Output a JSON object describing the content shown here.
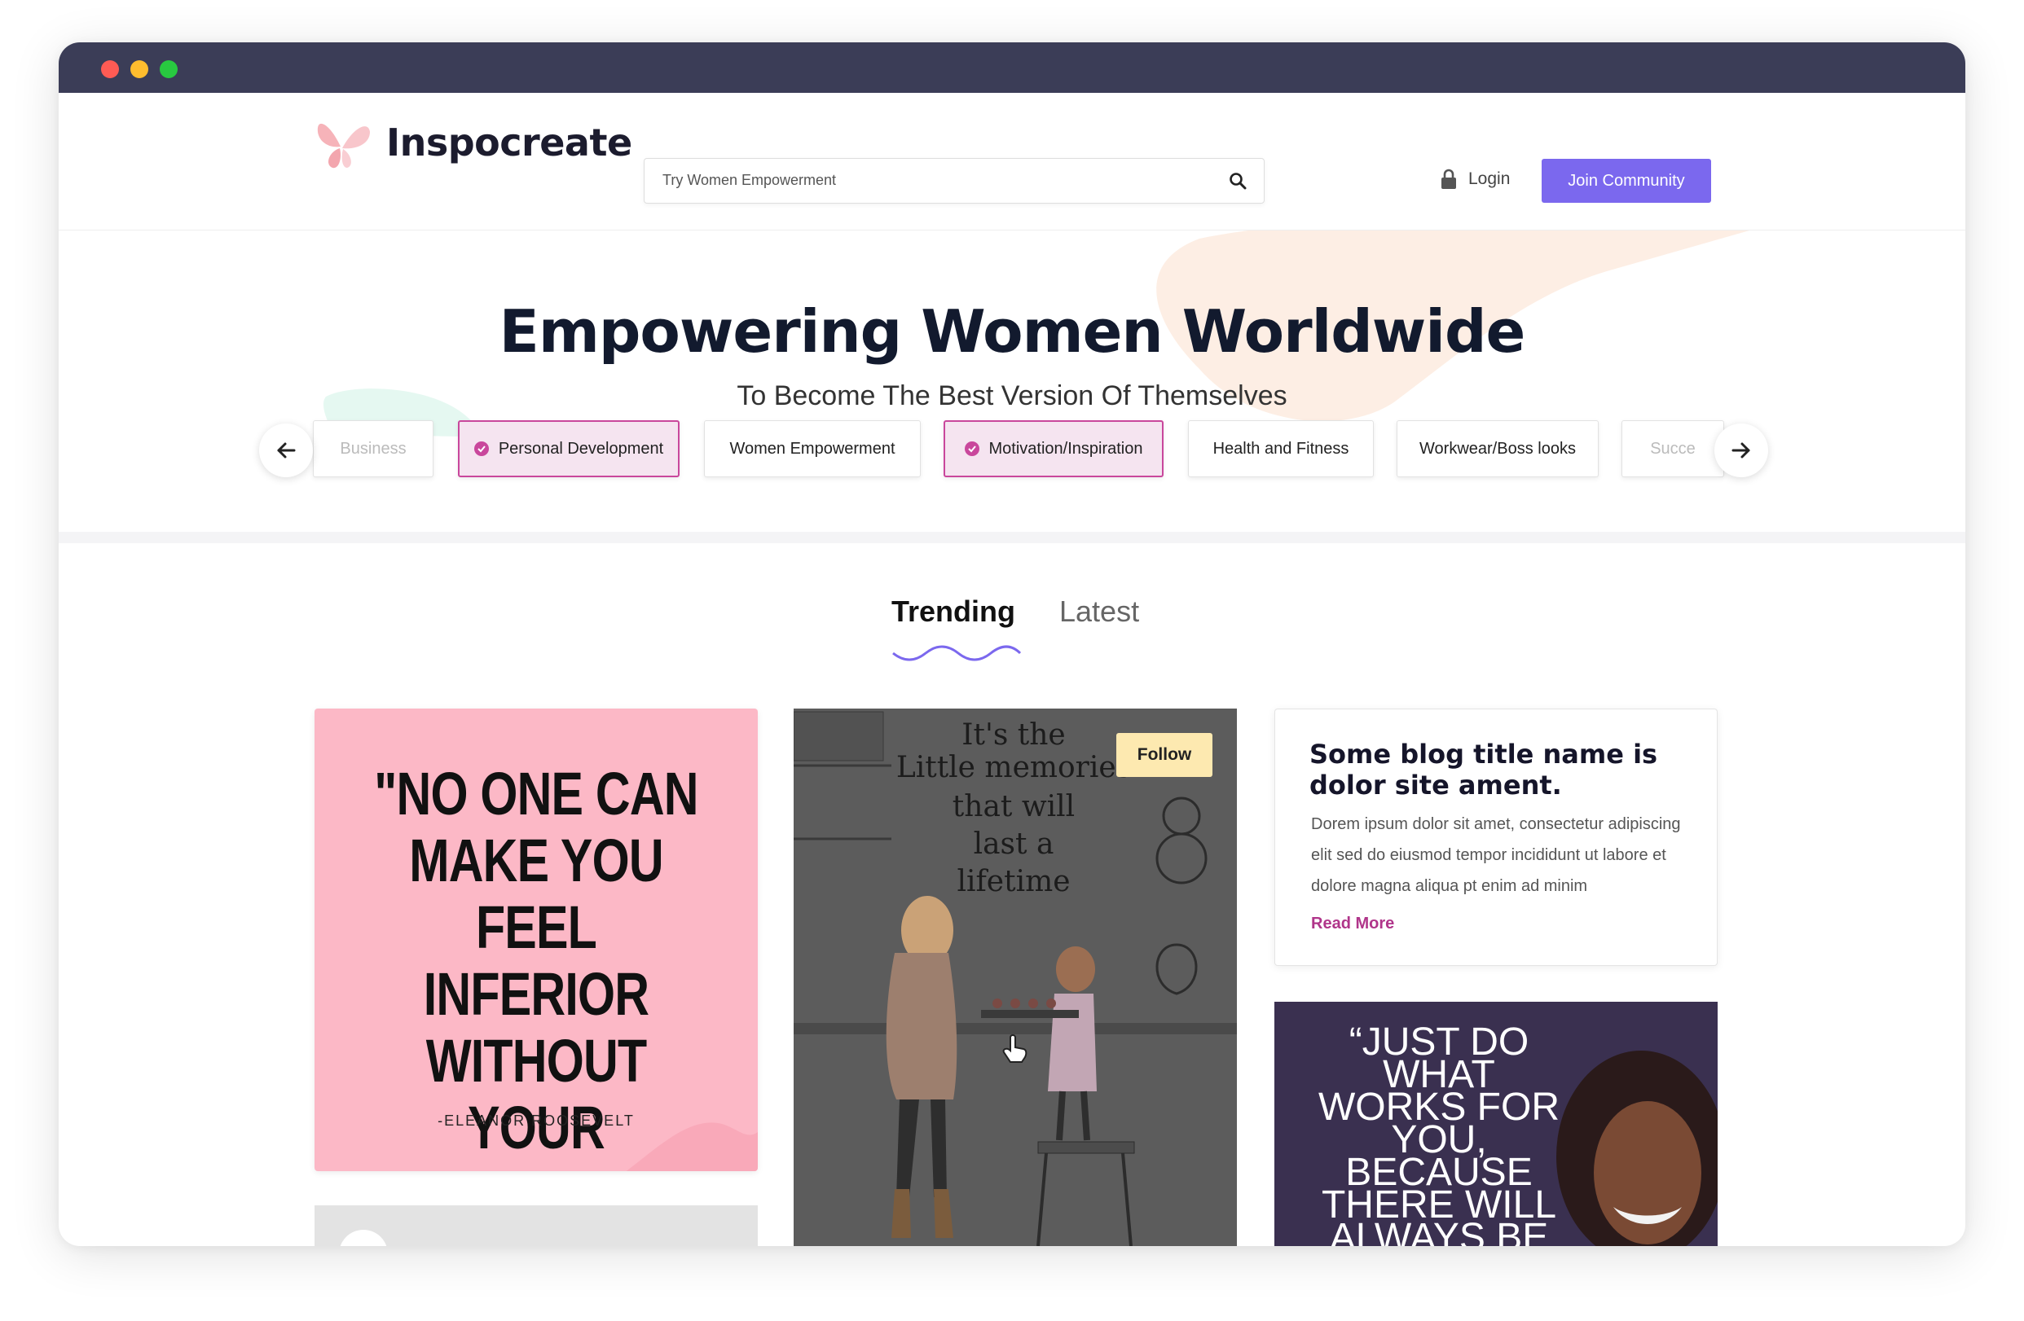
{
  "window": {
    "controls": [
      "close",
      "minimize",
      "maximize"
    ]
  },
  "nav": {
    "brand": "Inspocreate",
    "search_placeholder": "Try Women Empowerment",
    "login_label": "Login",
    "join_label": "Join Community"
  },
  "hero": {
    "title": "Empowering Women Worldwide",
    "subtitle": "To Become The Best Version Of Themselves"
  },
  "categories": [
    {
      "label": "Business",
      "selected": false
    },
    {
      "label": "Personal Development",
      "selected": true
    },
    {
      "label": "Women Empowerment",
      "selected": false
    },
    {
      "label": "Motivation/Inspiration",
      "selected": true
    },
    {
      "label": "Health and Fitness",
      "selected": false
    },
    {
      "label": "Workwear/Boss looks",
      "selected": false
    },
    {
      "label": "Succe",
      "selected": false
    }
  ],
  "tabs": {
    "active": "Trending",
    "inactive": "Latest"
  },
  "feed": {
    "quote_card": {
      "quote": "\"NO ONE CAN MAKE YOU FEEL INFERIOR WITHOUT YOUR CONSENT.\"",
      "author": "-ELEANOR ROOSEVELT"
    },
    "illustration_card": {
      "follow_label": "Follow",
      "text_lines": [
        "It's the",
        "Little memories",
        "that will",
        "last a",
        "lifetime"
      ]
    },
    "blog_card": {
      "title": "Some blog title name is dolor site ament.",
      "excerpt": "Dorem ipsum dolor sit amet, consectetur adipiscing elit sed do eiusmod tempor incididunt ut labore et dolore magna aliqua pt enim ad minim",
      "read_more": "Read More"
    },
    "quote_card_2": {
      "quote": "“JUST DO WHAT WORKS FOR YOU, BECAUSE THERE WILL ALWAYS BE SOMEONE"
    }
  },
  "colors": {
    "accent": "#7b68ee",
    "brand_pink": "#c9479c",
    "titlebar": "#3b3d57",
    "quote_pink": "#fcb8c6"
  }
}
